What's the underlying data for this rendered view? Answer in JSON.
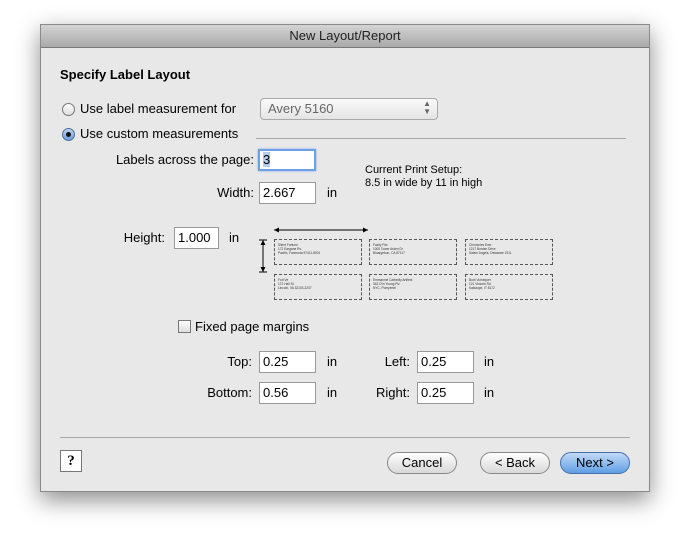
{
  "window": {
    "title": "New Layout/Report"
  },
  "heading": "Specify Label Layout",
  "options": {
    "use_label_measurement": "Use label measurement for",
    "label_preset": "Avery 5160",
    "use_custom": "Use custom measurements"
  },
  "fields": {
    "labels_across_label": "Labels across the page:",
    "labels_across_value": "3",
    "width_label": "Width:",
    "width_value": "2.667",
    "width_unit": "in",
    "height_label": "Height:",
    "height_value": "1.000",
    "height_unit": "in"
  },
  "print_setup": {
    "line1": "Current Print Setup:",
    "line2": "8.5 in wide by 11 in high"
  },
  "preview_labels": [
    {
      "line1": "Silent Fortune",
      "line2": "172 Eargane Rv.",
      "line3": "Pacific, Fanmoda 97411-8001"
    },
    {
      "line1": "Fazily Fier",
      "line2": "1000 Tower Arden Dr",
      "line3": "Bluargebun, CA 87117"
    },
    {
      "line1": "Chronicles Ever",
      "line2": "1217 Borden Drive",
      "line3": "Salem Angels, Delaware 1911"
    },
    {
      "line1": "Fort Ve",
      "line2": "172 Hall St",
      "line3": "Lincoln, VA 32103-2207"
    },
    {
      "line1": "Emmannel Cathedly Artifect",
      "line2": "343 D'in Young Plz",
      "line3": "NYC, Pompenel"
    },
    {
      "line1": "Bont Vulnequer",
      "line2": "121 Victorin Rd",
      "line3": "Kalkaupe, IT 8172"
    }
  ],
  "margins": {
    "fixed_label": "Fixed page margins",
    "top_label": "Top:",
    "top_value": "0.25",
    "left_label": "Left:",
    "left_value": "0.25",
    "bottom_label": "Bottom:",
    "bottom_value": "0.56",
    "right_label": "Right:",
    "right_value": "0.25",
    "unit": "in"
  },
  "buttons": {
    "help": "?",
    "cancel": "Cancel",
    "back": "< Back",
    "next": "Next >"
  }
}
